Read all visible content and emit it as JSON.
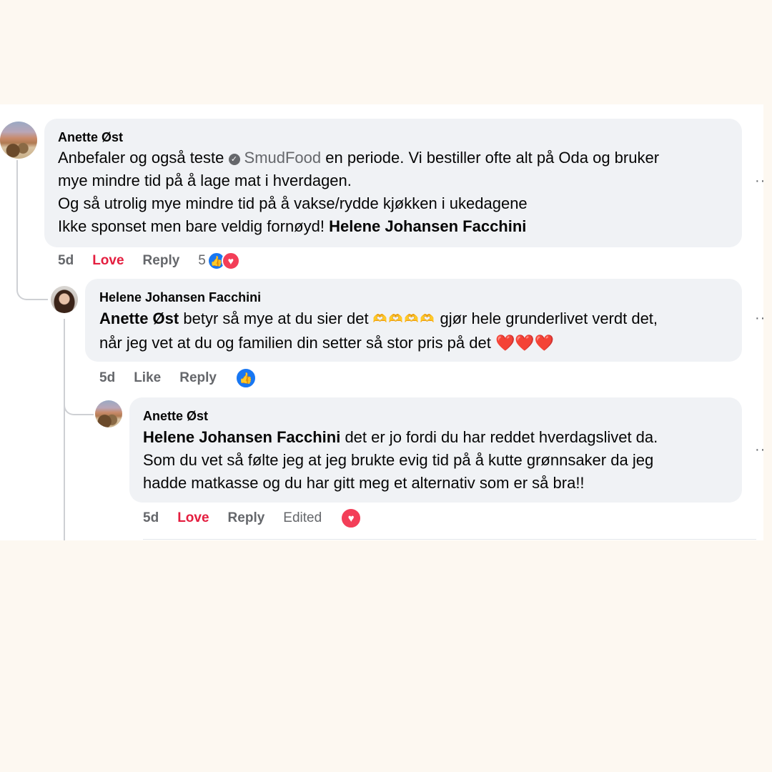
{
  "comments": [
    {
      "author": "Anette Øst",
      "line1_pre": "Anbefaler og også teste",
      "page_mention": "SmudFood",
      "line1_post": "en periode. Vi bestiller ofte alt på Oda og bruker",
      "line2": "mye mindre tid på å lage mat i hverdagen.",
      "line3": "Og så utrolig mye mindre tid på å vakse/rydde kjøkken i ukedagene",
      "line4_pre": "Ikke sponset men bare veldig fornøyd!",
      "line4_mention": "Helene Johansen Facchini",
      "time": "5d",
      "reaction_label": "Love",
      "reply_label": "Reply",
      "reaction_count": "5"
    },
    {
      "author": "Helene Johansen Facchini",
      "line1_mention": "Anette Øst",
      "line1_pre": "betyr så mye at du sier det",
      "line1_emoji": "🫶🫶🫶🫶",
      "line1_post": "gjør hele grunderlivet verdt det,",
      "line2": "når jeg vet at du og familien din setter så stor pris på det",
      "line2_emoji": "❤️❤️❤️",
      "time": "5d",
      "reaction_label": "Like",
      "reply_label": "Reply"
    },
    {
      "author": "Anette Øst",
      "line1_mention": "Helene Johansen Facchini",
      "line1_post": "det er jo fordi du har reddet hverdagslivet da.",
      "line2": "Som du vet så følte jeg at jeg brukte evig tid på å kutte grønnsaker da jeg",
      "line3": "hadde matkasse og du har gitt meg et alternativ som er så bra!!",
      "time": "5d",
      "reaction_label": "Love",
      "reply_label": "Reply",
      "edited_label": "Edited"
    }
  ],
  "icons": {
    "more": "more-dots-icon",
    "like": "like-reaction-icon",
    "love": "love-reaction-icon",
    "verified": "verified-badge-icon"
  },
  "colors": {
    "background": "#fdf8f1",
    "bubble": "#f0f2f5",
    "love": "#e41e3f",
    "like_blue": "#1877f2",
    "muted": "#65676b"
  }
}
